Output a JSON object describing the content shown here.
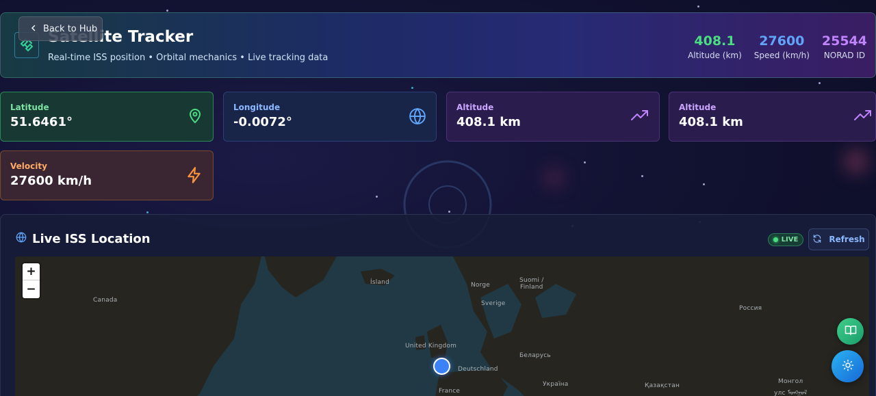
{
  "header": {
    "title": "Satellite Tracker",
    "subtitle": "Real-time ISS position • Orbital mechanics • Live tracking data",
    "back_label": "Back to Hub",
    "stats": [
      {
        "value": "408.1",
        "label": "Altitude (km)",
        "color": "#4ade80"
      },
      {
        "value": "27600",
        "label": "Speed (km/h)",
        "color": "#60a5fa"
      },
      {
        "value": "25544",
        "label": "NORAD ID",
        "color": "#c084fc"
      }
    ]
  },
  "cards": {
    "latitude": {
      "label": "Latitude",
      "value": "51.6461°",
      "icon": "map-pin-icon"
    },
    "longitude": {
      "label": "Longitude",
      "value": "-0.0072°",
      "icon": "globe-icon"
    },
    "altitude_1": {
      "label": "Altitude",
      "value": "408.1 km",
      "icon": "trending-up-icon"
    },
    "altitude_2": {
      "label": "Altitude",
      "value": "408.1 km",
      "icon": "trending-up-icon"
    },
    "velocity": {
      "label": "Velocity",
      "value": "27600 km/h",
      "icon": "zap-icon"
    }
  },
  "map_panel": {
    "title": "Live ISS Location",
    "live_label": "LIVE",
    "refresh_label": "Refresh",
    "zoom_in": "+",
    "zoom_out": "−",
    "labels": {
      "canada": "Canada",
      "island": "Ísland",
      "norge": "Norge",
      "suomi": "Suomi /",
      "finland": "Finland",
      "sverige": "Sverige",
      "rossiya": "Россия",
      "uk": "United Kingdom",
      "belarus": "Беларусь",
      "deutschland": "Deutschland",
      "ukraina": "Україна",
      "france": "France",
      "kazakhstan": "Қазақстан",
      "mongol": "Монгол",
      "mongol2": "улс ᠮᠣᠩᠭᠣᠯ"
    }
  },
  "colors": {
    "accent_green": "#4ade80",
    "accent_blue": "#60a5fa",
    "accent_purple": "#c084fc",
    "accent_orange": "#fb923c"
  }
}
